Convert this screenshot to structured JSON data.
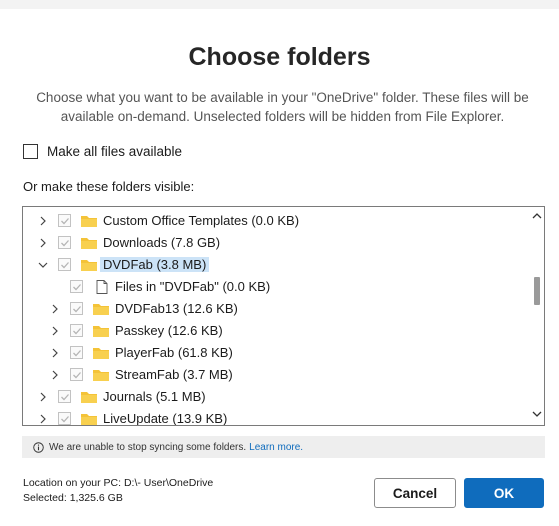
{
  "dialog": {
    "title": "Choose folders",
    "subtitle": "Choose what you want to be available in your \"OneDrive\" folder. These files will be available on-demand. Unselected folders will be hidden from File Explorer.",
    "make_all_label": "Make all files available",
    "or_label": "Or make these folders visible:"
  },
  "tree": {
    "rows": [
      {
        "label": "Custom Office Templates  (0.0 KB)",
        "type": "folder",
        "chevron": "right",
        "level": 0,
        "selected": false
      },
      {
        "label": "Downloads  (7.8 GB)",
        "type": "folder",
        "chevron": "right",
        "level": 0,
        "selected": false
      },
      {
        "label": "DVDFab  (3.8 MB)",
        "type": "folder",
        "chevron": "down",
        "level": 0,
        "selected": true
      },
      {
        "label": "Files in \"DVDFab\"  (0.0 KB)",
        "type": "file",
        "chevron": "none",
        "level": 1,
        "selected": false
      },
      {
        "label": "DVDFab13  (12.6 KB)",
        "type": "folder",
        "chevron": "right",
        "level": 1,
        "selected": false
      },
      {
        "label": "Passkey  (12.6 KB)",
        "type": "folder",
        "chevron": "right",
        "level": 1,
        "selected": false
      },
      {
        "label": "PlayerFab  (61.8 KB)",
        "type": "folder",
        "chevron": "right",
        "level": 1,
        "selected": false
      },
      {
        "label": "StreamFab  (3.7 MB)",
        "type": "folder",
        "chevron": "right",
        "level": 1,
        "selected": false
      },
      {
        "label": "Journals  (5.1 MB)",
        "type": "folder",
        "chevron": "right",
        "level": 0,
        "selected": false
      },
      {
        "label": "LiveUpdate  (13.9 KB)",
        "type": "folder",
        "chevron": "right",
        "level": 0,
        "selected": false
      }
    ]
  },
  "notice": {
    "text": "We are unable to stop syncing some folders.",
    "link": "Learn more."
  },
  "footer": {
    "location": "Location on your PC: D:\\- User\\OneDrive",
    "selected": "Selected: 1,325.6 GB",
    "cancel_label": "Cancel",
    "ok_label": "OK"
  },
  "colors": {
    "accent": "#0f6cbd",
    "folder": "#f4c338",
    "selection": "#cce3f7"
  }
}
